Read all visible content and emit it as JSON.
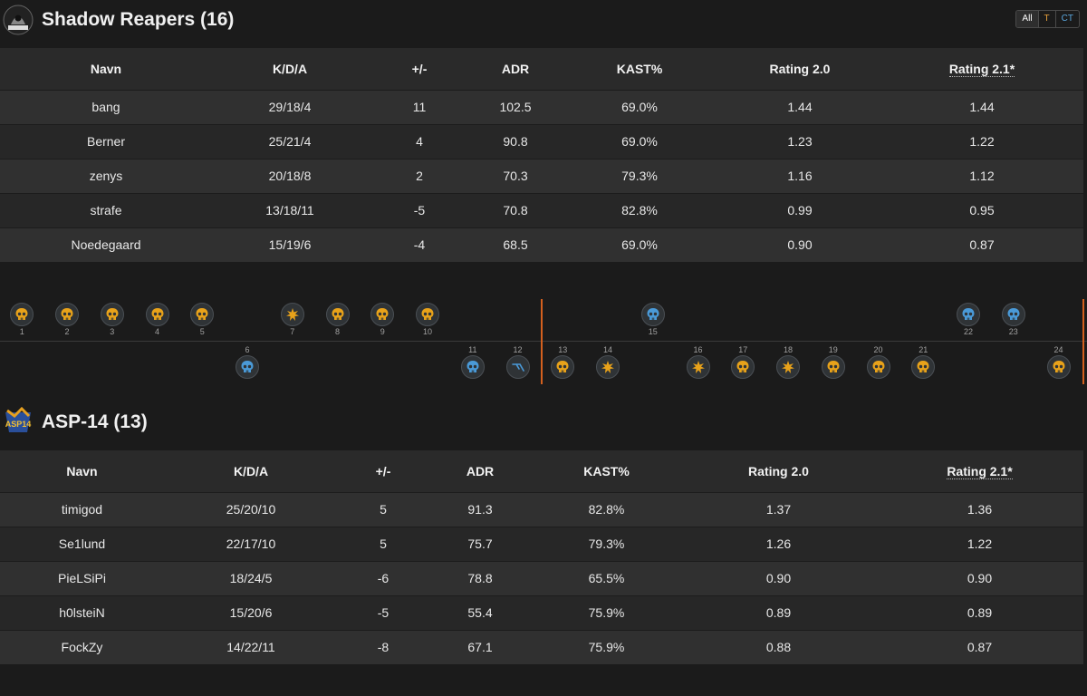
{
  "filter": {
    "all": "All",
    "t": "T",
    "ct": "CT"
  },
  "columns": [
    "Navn",
    "K/D/A",
    "+/-",
    "ADR",
    "KAST%",
    "Rating 2.0",
    "Rating 2.1*"
  ],
  "teams": [
    {
      "name": "Shadow Reapers (16)",
      "logo": "shadow-reapers-logo",
      "players": [
        {
          "name": "bang",
          "kda": "29/18/4",
          "diff": "11",
          "adr": "102.5",
          "kast": "69.0%",
          "r20": "1.44",
          "r21": "1.44"
        },
        {
          "name": "Berner",
          "kda": "25/21/4",
          "diff": "4",
          "adr": "90.8",
          "kast": "69.0%",
          "r20": "1.23",
          "r21": "1.22"
        },
        {
          "name": "zenys",
          "kda": "20/18/8",
          "diff": "2",
          "adr": "70.3",
          "kast": "79.3%",
          "r20": "1.16",
          "r21": "1.12"
        },
        {
          "name": "strafe",
          "kda": "13/18/11",
          "diff": "-5",
          "adr": "70.8",
          "kast": "82.8%",
          "r20": "0.99",
          "r21": "0.95"
        },
        {
          "name": "Noedegaard",
          "kda": "15/19/6",
          "diff": "-4",
          "adr": "68.5",
          "kast": "69.0%",
          "r20": "0.90",
          "r21": "0.87"
        }
      ]
    },
    {
      "name": "ASP-14 (13)",
      "logo": "asp-14-logo",
      "players": [
        {
          "name": "timigod",
          "kda": "25/20/10",
          "diff": "5",
          "adr": "91.3",
          "kast": "82.8%",
          "r20": "1.37",
          "r21": "1.36"
        },
        {
          "name": "Se1lund",
          "kda": "22/17/10",
          "diff": "5",
          "adr": "75.7",
          "kast": "79.3%",
          "r20": "1.26",
          "r21": "1.22"
        },
        {
          "name": "PieLSiPi",
          "kda": "18/24/5",
          "diff": "-6",
          "adr": "78.8",
          "kast": "65.5%",
          "r20": "0.90",
          "r21": "0.90"
        },
        {
          "name": "h0lsteiN",
          "kda": "15/20/6",
          "diff": "-5",
          "adr": "55.4",
          "kast": "75.9%",
          "r20": "0.89",
          "r21": "0.89"
        },
        {
          "name": "FockZy",
          "kda": "14/22/11",
          "diff": "-8",
          "adr": "67.1",
          "kast": "75.9%",
          "r20": "0.88",
          "r21": "0.87"
        }
      ]
    }
  ],
  "timeline": {
    "colors": {
      "t": "#e8a21a",
      "ct": "#4a9ad8",
      "half": "#d4601e"
    },
    "rounds": [
      {
        "n": "1",
        "winner": "top",
        "side": "t",
        "icon": "skull-icon"
      },
      {
        "n": "2",
        "winner": "top",
        "side": "t",
        "icon": "skull-icon"
      },
      {
        "n": "3",
        "winner": "top",
        "side": "t",
        "icon": "skull-icon"
      },
      {
        "n": "4",
        "winner": "top",
        "side": "t",
        "icon": "skull-icon"
      },
      {
        "n": "5",
        "winner": "top",
        "side": "t",
        "icon": "skull-icon"
      },
      {
        "n": "6",
        "winner": "bottom",
        "side": "ct",
        "icon": "skull-icon"
      },
      {
        "n": "7",
        "winner": "top",
        "side": "t",
        "icon": "bomb-exploded-icon"
      },
      {
        "n": "8",
        "winner": "top",
        "side": "t",
        "icon": "skull-icon"
      },
      {
        "n": "9",
        "winner": "top",
        "side": "t",
        "icon": "skull-icon"
      },
      {
        "n": "10",
        "winner": "top",
        "side": "t",
        "icon": "skull-icon"
      },
      {
        "n": "11",
        "winner": "bottom",
        "side": "ct",
        "icon": "skull-icon"
      },
      {
        "n": "12",
        "winner": "bottom",
        "side": "ct",
        "icon": "defuse-icon"
      },
      {
        "n": "13",
        "winner": "bottom",
        "side": "t",
        "icon": "skull-icon"
      },
      {
        "n": "14",
        "winner": "bottom",
        "side": "t",
        "icon": "bomb-exploded-icon"
      },
      {
        "n": "15",
        "winner": "top",
        "side": "ct",
        "icon": "skull-icon"
      },
      {
        "n": "16",
        "winner": "bottom",
        "side": "t",
        "icon": "bomb-exploded-icon"
      },
      {
        "n": "17",
        "winner": "bottom",
        "side": "t",
        "icon": "skull-icon"
      },
      {
        "n": "18",
        "winner": "bottom",
        "side": "t",
        "icon": "bomb-exploded-icon"
      },
      {
        "n": "19",
        "winner": "bottom",
        "side": "t",
        "icon": "skull-icon"
      },
      {
        "n": "20",
        "winner": "bottom",
        "side": "t",
        "icon": "skull-icon"
      },
      {
        "n": "21",
        "winner": "bottom",
        "side": "t",
        "icon": "skull-icon"
      },
      {
        "n": "22",
        "winner": "top",
        "side": "ct",
        "icon": "skull-icon"
      },
      {
        "n": "23",
        "winner": "top",
        "side": "ct",
        "icon": "skull-icon"
      },
      {
        "n": "24",
        "winner": "bottom",
        "side": "t",
        "icon": "skull-icon"
      }
    ]
  }
}
